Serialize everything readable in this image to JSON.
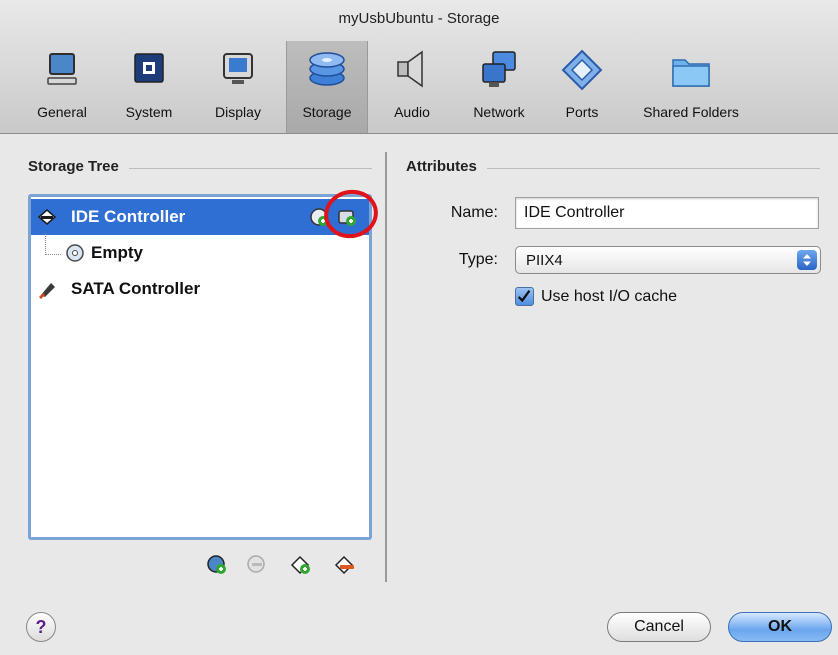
{
  "window": {
    "title": "myUsbUbuntu - Storage"
  },
  "toolbar": {
    "items": [
      {
        "label": "General",
        "icon": "monitor-icon"
      },
      {
        "label": "System",
        "icon": "chip-icon"
      },
      {
        "label": "Display",
        "icon": "display-icon"
      },
      {
        "label": "Storage",
        "icon": "disk-stack-icon",
        "selected": true
      },
      {
        "label": "Audio",
        "icon": "speaker-icon"
      },
      {
        "label": "Network",
        "icon": "network-icon"
      },
      {
        "label": "Ports",
        "icon": "ports-icon"
      },
      {
        "label": "Shared Folders",
        "icon": "folder-icon"
      }
    ]
  },
  "storage_tree": {
    "header": "Storage Tree",
    "items": [
      {
        "label": "IDE Controller",
        "selected": true,
        "icon": "ide-controller-icon"
      },
      {
        "label": "Empty",
        "icon": "cd-icon"
      },
      {
        "label": "SATA Controller",
        "icon": "sata-controller-icon"
      }
    ],
    "row_actions": [
      "add-cd-icon",
      "add-hard-disk-icon"
    ],
    "bottom_buttons": [
      "add-attachment-icon",
      "remove-attachment-icon",
      "add-controller-icon",
      "remove-controller-icon"
    ]
  },
  "attributes": {
    "header": "Attributes",
    "name_label": "Name:",
    "name_value": "IDE Controller",
    "type_label": "Type:",
    "type_value": "PIIX4",
    "cache_label": "Use host I/O cache",
    "cache_checked": true
  },
  "buttons": {
    "help": "?",
    "cancel": "Cancel",
    "ok": "OK"
  },
  "colors": {
    "selection": "#2f6fd4",
    "annotation": "#e0121a",
    "default_button": "#6aa6ef"
  }
}
